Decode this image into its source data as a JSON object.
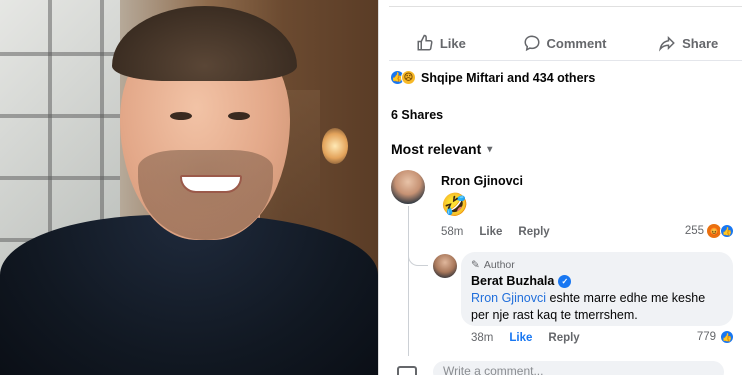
{
  "post_actions": {
    "like_label": "Like",
    "comment_label": "Comment",
    "share_label": "Share"
  },
  "reactions": {
    "summary": "Shqipe Miftari and 434 others"
  },
  "shares": "6 Shares",
  "sort": {
    "label": "Most relevant"
  },
  "comments": [
    {
      "author": "Rron Gjinovci",
      "text": "🤣",
      "time": "58m",
      "like_label": "Like",
      "reply_label": "Reply",
      "reaction_count": "255"
    }
  ],
  "reply": {
    "author_badge": "Author",
    "author": "Berat Buzhala",
    "mention": "Rron Gjinovci",
    "text": " eshte marre edhe me keshe per nje rast kaq te tmerrshem.",
    "time": "38m",
    "like_label": "Like",
    "reply_label": "Reply",
    "reaction_count": "779"
  },
  "comment_input": {
    "placeholder": "Write a comment..."
  },
  "colors": {
    "facebook_blue": "#1877f2",
    "bubble_bg": "#f0f2f5",
    "secondary_text": "#65676b"
  }
}
